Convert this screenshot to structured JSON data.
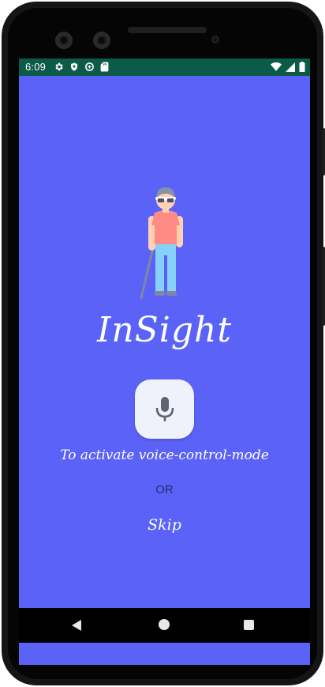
{
  "status_bar": {
    "time": "6:09",
    "left_icons": [
      "gear-icon",
      "shield-icon",
      "data-saver-icon",
      "sd-card-icon"
    ],
    "right_icons": [
      "wifi-icon",
      "signal-icon",
      "battery-icon"
    ],
    "color": "#0C5A48"
  },
  "app": {
    "background": "#5A62F7",
    "title": "InSight",
    "mic_icon": "microphone-icon",
    "voice_prompt": "To activate voice-control-mode",
    "or_label": "OR",
    "skip_label": "Skip"
  },
  "nav_bar": {
    "buttons": [
      "back",
      "home",
      "recents"
    ]
  }
}
